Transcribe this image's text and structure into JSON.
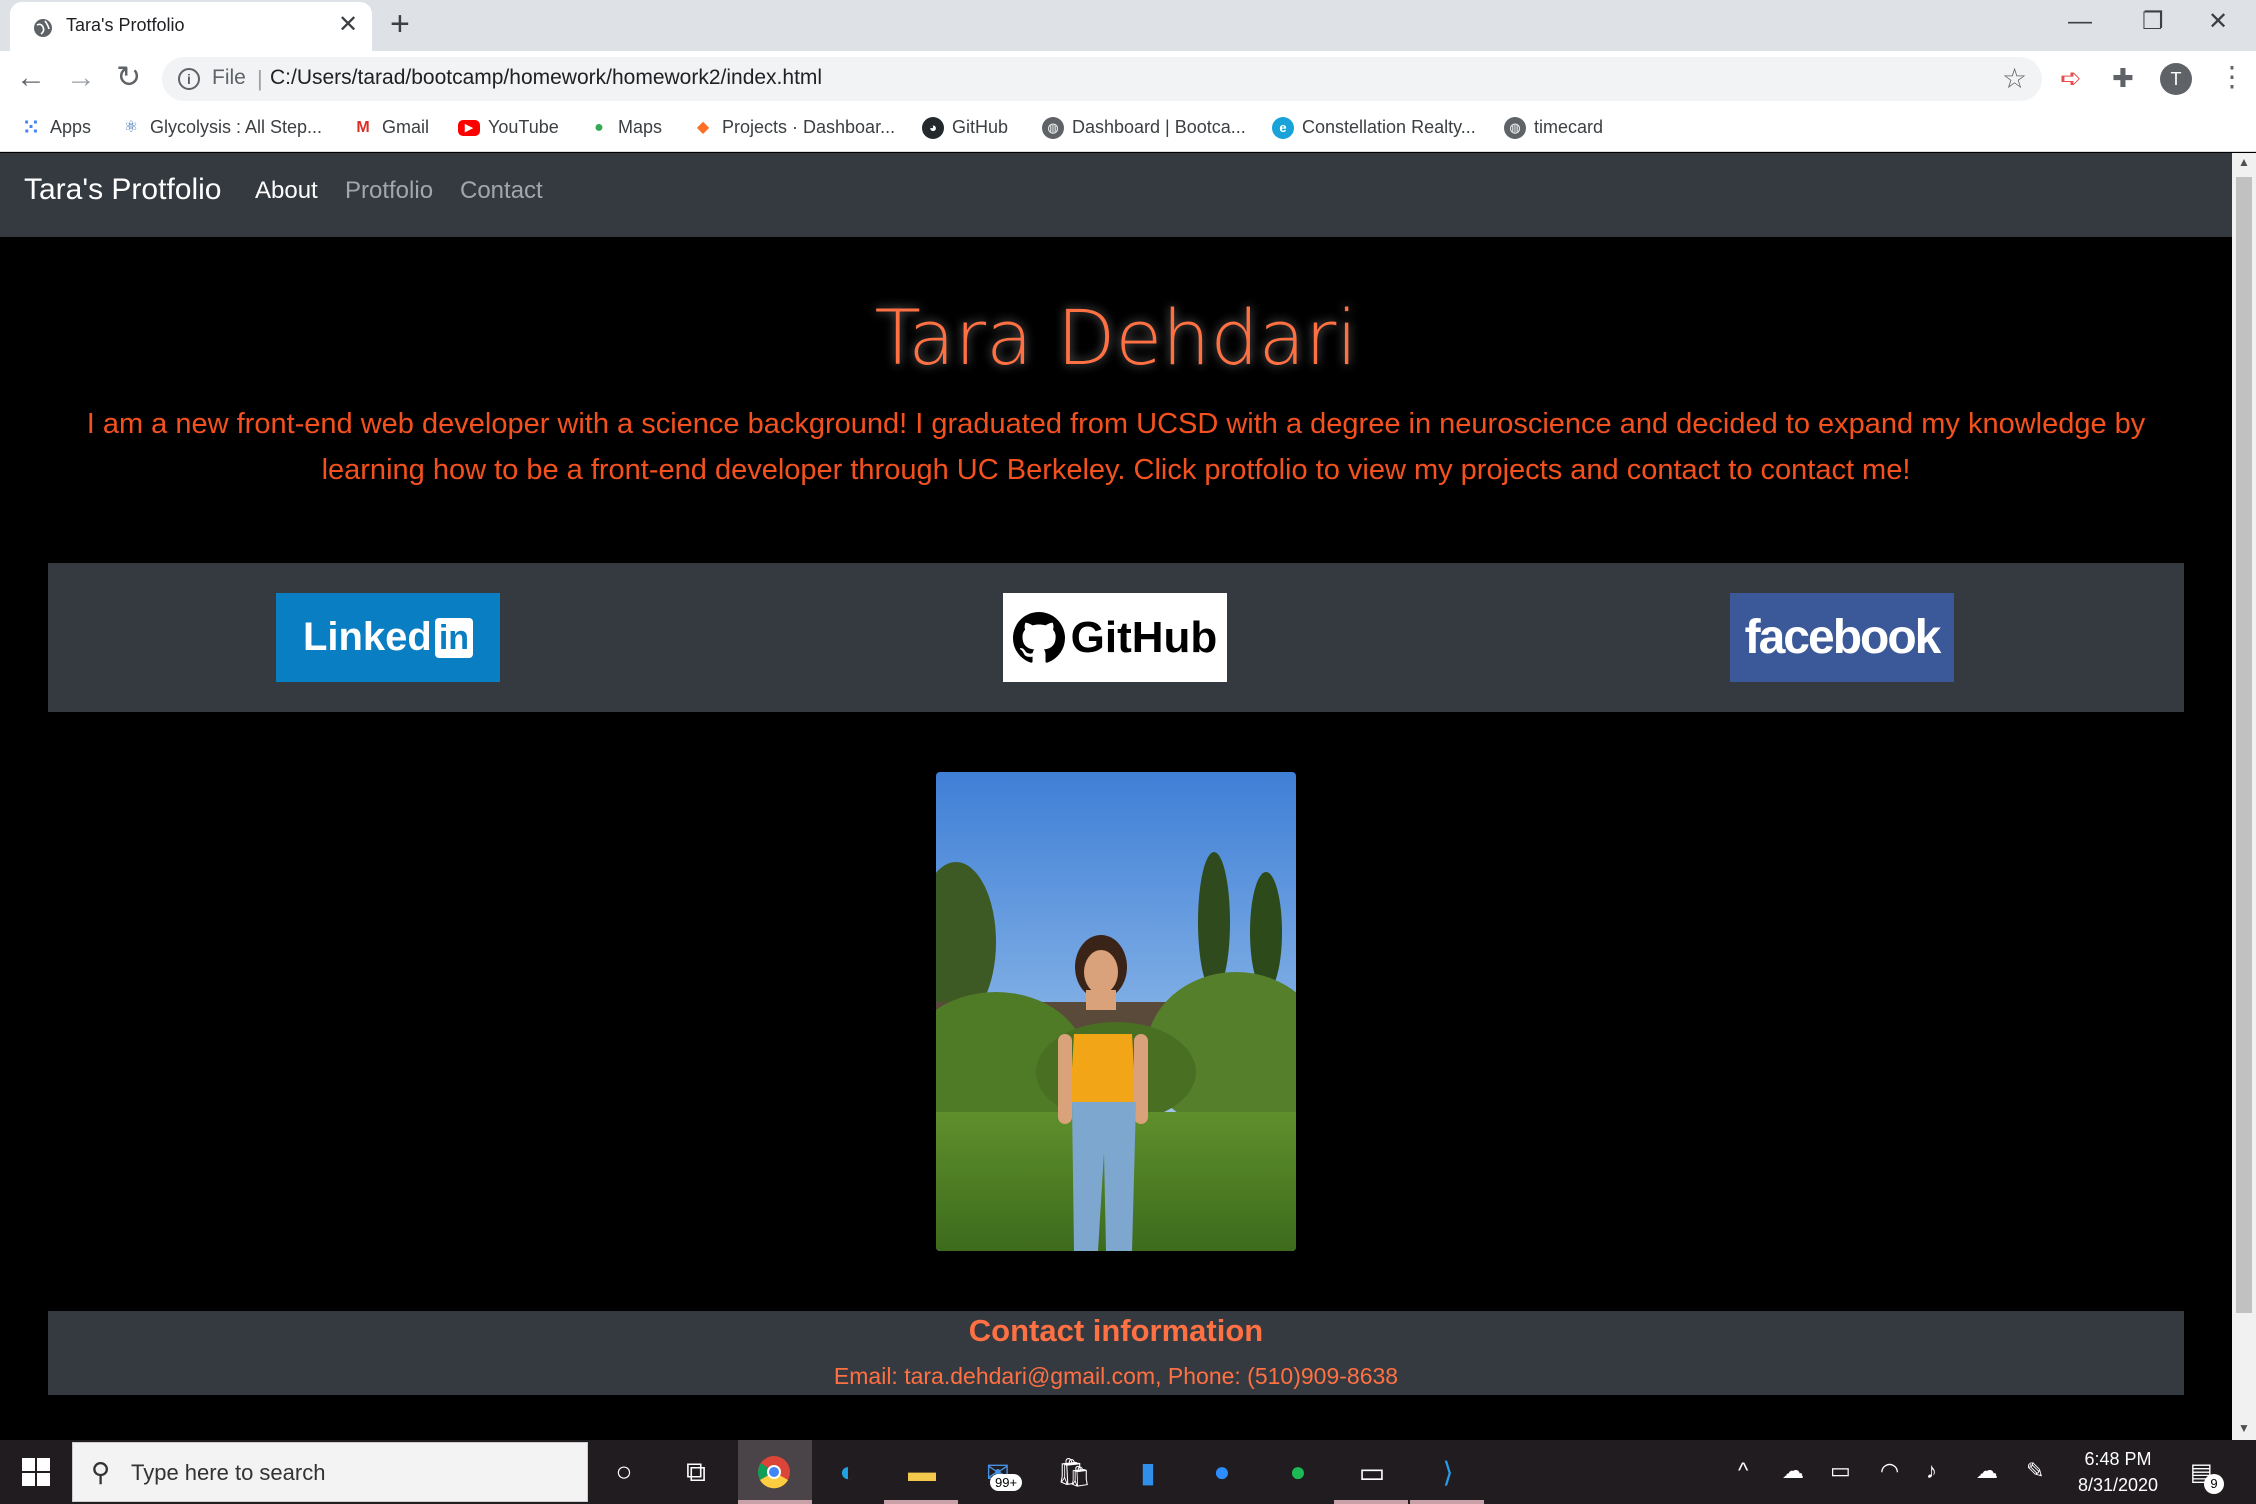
{
  "browser": {
    "tab_title": "Tara's Protfolio",
    "tab_close": "✕",
    "new_tab": "+",
    "scheme": "File",
    "url": "C:/Users/tarad/bootcamp/homework/homework2/index.html",
    "profile_initial": "T",
    "bookmarks": [
      {
        "label": "Apps",
        "icon": "apps-grid-icon"
      },
      {
        "label": "Glycolysis : All Step...",
        "icon": "glycolysis-icon"
      },
      {
        "label": "Gmail",
        "icon": "gmail-icon"
      },
      {
        "label": "YouTube",
        "icon": "youtube-icon"
      },
      {
        "label": "Maps",
        "icon": "maps-pin-icon"
      },
      {
        "label": "Projects · Dashboar...",
        "icon": "gitlab-icon"
      },
      {
        "label": "GitHub",
        "icon": "github-icon"
      },
      {
        "label": "Dashboard | Bootca...",
        "icon": "globe-icon"
      },
      {
        "label": "Constellation Realty...",
        "icon": "constellation-icon"
      },
      {
        "label": "timecard",
        "icon": "globe-icon"
      }
    ]
  },
  "page": {
    "brand": "Tara's Protfolio",
    "nav": [
      "About",
      "Protfolio",
      "Contact"
    ],
    "active_nav": "About",
    "name": "Tara Dehdari",
    "bio": "I am a new front-end web developer with a science background! I graduated from UCSD with a degree in neuroscience and decided to expand my knowledge by learning how to be a front-end developer through UC Berkeley. Click protfolio to view my projects and contact to contact me!",
    "social": {
      "linkedin_text": "Linked",
      "linkedin_in": "in",
      "github_text": "GitHub",
      "facebook_text": "facebook"
    },
    "contact_title": "Contact information",
    "contact_line": "Email: tara.dehdari@gmail.com, Phone: (510)909-8638"
  },
  "taskbar": {
    "search_placeholder": "Type here to search",
    "mail_badge": "99+",
    "time": "6:48 PM",
    "date": "8/31/2020",
    "notification_count": "9"
  },
  "colors": {
    "accent": "#ff7043",
    "navbar": "#343a40",
    "linkedin": "#0a7ec2",
    "facebook": "#3b5998"
  }
}
